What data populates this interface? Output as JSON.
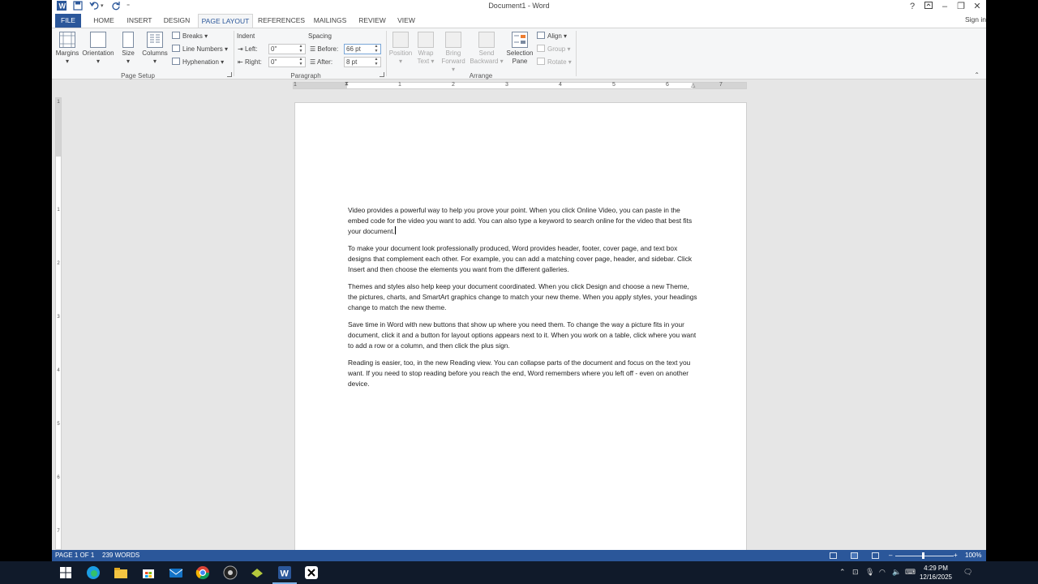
{
  "app": {
    "title": "Document1 - Word",
    "sign_in": "Sign in"
  },
  "tabs": [
    "FILE",
    "HOME",
    "INSERT",
    "DESIGN",
    "PAGE LAYOUT",
    "REFERENCES",
    "MAILINGS",
    "REVIEW",
    "VIEW"
  ],
  "active_tab": "PAGE LAYOUT",
  "ribbon": {
    "page_setup": {
      "margins": "Margins",
      "orientation": "Orientation",
      "size": "Size",
      "columns": "Columns",
      "breaks": "Breaks",
      "line_numbers": "Line Numbers",
      "hyphenation": "Hyphenation",
      "group_label": "Page Setup"
    },
    "paragraph": {
      "indent_label": "Indent",
      "spacing_label": "Spacing",
      "left_label": "Left:",
      "right_label": "Right:",
      "before_label": "Before:",
      "after_label": "After:",
      "left_value": "0\"",
      "right_value": "0\"",
      "before_value": "66 pt",
      "after_value": "8 pt",
      "group_label": "Paragraph"
    },
    "arrange": {
      "position": "Position",
      "wrap_text": [
        "Wrap",
        "Text"
      ],
      "bring_forward": [
        "Bring",
        "Forward"
      ],
      "send_backward": [
        "Send",
        "Backward"
      ],
      "selection_pane": [
        "Selection",
        "Pane"
      ],
      "align": "Align",
      "group": "Group",
      "rotate": "Rotate",
      "group_label": "Arrange"
    }
  },
  "ruler": {
    "numbers": [
      "1",
      "1",
      "2",
      "3",
      "4",
      "5",
      "6",
      "7"
    ],
    "v_numbers": [
      "1",
      "1",
      "2",
      "3",
      "4",
      "5",
      "6",
      "7"
    ]
  },
  "document": {
    "paragraphs": [
      "Video provides a powerful way to help you prove your point. When you click Online Video, you can paste in the embed code for the video you want to add. You can also type a keyword to search online for the video that best fits your document.",
      "To make your document look professionally produced, Word provides header, footer, cover page, and text box designs that complement each other. For example, you can add a matching cover page, header, and sidebar. Click Insert and then choose the elements you want from the different galleries.",
      "Themes and styles also help keep your document coordinated. When you click Design and choose a new Theme, the pictures, charts, and SmartArt graphics change to match your new theme. When you apply styles, your headings change to match the new theme.",
      "Save time in Word with new buttons that show up where you need them. To change the way a picture fits in your document, click it and a button for layout options appears next to it. When you work on a table, click where you want to add a row or a column, and then click the plus sign.",
      "Reading is easier, too, in the new Reading view. You can collapse parts of the document and focus on the text you want. If you need to stop reading before you reach the end, Word remembers where you left off - even on another device."
    ]
  },
  "status": {
    "page": "PAGE 1 OF 1",
    "words": "239 WORDS",
    "zoom": "100%"
  },
  "taskbar": {
    "time": "4:29 PM",
    "date": "12/16/2025"
  },
  "colors": {
    "accent": "#2b579a",
    "taskbar": "#101a2a"
  }
}
